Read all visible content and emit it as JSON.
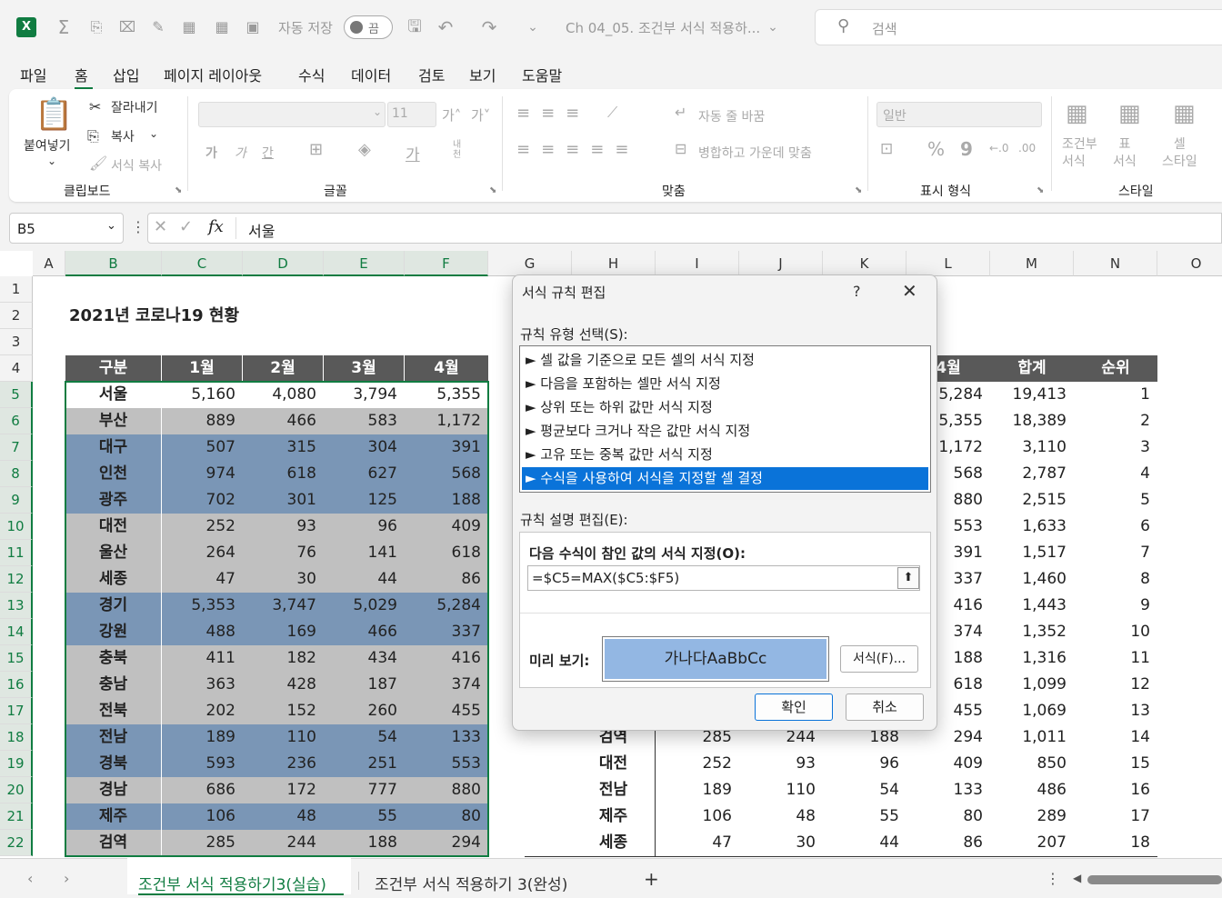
{
  "titlebar": {
    "autosave_label": "자동 저장",
    "autosave_state": "끔",
    "doc_title": "Ch 04_05. 조건부 서식 적용하...",
    "search_placeholder": "검색"
  },
  "menu_tabs": [
    "파일",
    "홈",
    "삽입",
    "페이지 레이아웃",
    "수식",
    "데이터",
    "검토",
    "보기",
    "도움말"
  ],
  "ribbon": {
    "paste": "붙여넣기",
    "cut": "잘라내기",
    "copy": "복사",
    "format_painter": "서식 복사",
    "clipboard_group": "클립보드",
    "font_size": "11",
    "font_group": "글꼴",
    "wrap_text": "자동 줄 바꿈",
    "merge_center": "병합하고 가운데 맞춤",
    "align_group": "맞춤",
    "number_format": "일반",
    "number_group": "표시 형식",
    "cond_format": "조건부\n서식",
    "format_table": "표\n서식",
    "cell_style": "셀\n스타일",
    "style_group": "스타일",
    "font_bold": "가",
    "font_italic": "가",
    "font_underline": "간",
    "font_color": "가",
    "vertical": "내천"
  },
  "formula_bar": {
    "name_box": "B5",
    "fx": "fx",
    "content": "서울"
  },
  "columns": [
    "A",
    "B",
    "C",
    "D",
    "E",
    "F",
    "G",
    "H",
    "I",
    "J",
    "K",
    "L",
    "M",
    "N",
    "O"
  ],
  "rows": [
    "1",
    "2",
    "3",
    "4",
    "5",
    "6",
    "7",
    "8",
    "9",
    "10",
    "11",
    "12",
    "13",
    "14",
    "15",
    "16",
    "17",
    "18",
    "19",
    "20",
    "21",
    "22"
  ],
  "sheet_title": "2021년 코로나19 현황",
  "left_table": {
    "headers": [
      "구분",
      "1월",
      "2월",
      "3월",
      "4월"
    ],
    "rows": [
      {
        "name": "서울",
        "v": [
          "5,160",
          "4,080",
          "3,794",
          "5,355"
        ],
        "style": "white"
      },
      {
        "name": "부산",
        "v": [
          "889",
          "466",
          "583",
          "1,172"
        ],
        "style": "gray"
      },
      {
        "name": "대구",
        "v": [
          "507",
          "315",
          "304",
          "391"
        ],
        "style": "blue"
      },
      {
        "name": "인천",
        "v": [
          "974",
          "618",
          "627",
          "568"
        ],
        "style": "blue"
      },
      {
        "name": "광주",
        "v": [
          "702",
          "301",
          "125",
          "188"
        ],
        "style": "blue"
      },
      {
        "name": "대전",
        "v": [
          "252",
          "93",
          "96",
          "409"
        ],
        "style": "gray"
      },
      {
        "name": "울산",
        "v": [
          "264",
          "76",
          "141",
          "618"
        ],
        "style": "gray"
      },
      {
        "name": "세종",
        "v": [
          "47",
          "30",
          "44",
          "86"
        ],
        "style": "gray"
      },
      {
        "name": "경기",
        "v": [
          "5,353",
          "3,747",
          "5,029",
          "5,284"
        ],
        "style": "blue"
      },
      {
        "name": "강원",
        "v": [
          "488",
          "169",
          "466",
          "337"
        ],
        "style": "blue"
      },
      {
        "name": "충북",
        "v": [
          "411",
          "182",
          "434",
          "416"
        ],
        "style": "gray"
      },
      {
        "name": "충남",
        "v": [
          "363",
          "428",
          "187",
          "374"
        ],
        "style": "gray"
      },
      {
        "name": "전북",
        "v": [
          "202",
          "152",
          "260",
          "455"
        ],
        "style": "gray"
      },
      {
        "name": "전남",
        "v": [
          "189",
          "110",
          "54",
          "133"
        ],
        "style": "blue"
      },
      {
        "name": "경북",
        "v": [
          "593",
          "236",
          "251",
          "553"
        ],
        "style": "blue"
      },
      {
        "name": "경남",
        "v": [
          "686",
          "172",
          "777",
          "880"
        ],
        "style": "gray"
      },
      {
        "name": "제주",
        "v": [
          "106",
          "48",
          "55",
          "80"
        ],
        "style": "blue"
      },
      {
        "name": "검역",
        "v": [
          "285",
          "244",
          "188",
          "294"
        ],
        "style": "gray"
      }
    ]
  },
  "right_table": {
    "headers": [
      "4월",
      "합계",
      "순위"
    ],
    "rows": [
      {
        "h": "",
        "i": "",
        "j": "",
        "k": "",
        "l": "5,284",
        "m": "19,413",
        "n": "1"
      },
      {
        "h": "",
        "i": "",
        "j": "",
        "k": "",
        "l": "5,355",
        "m": "18,389",
        "n": "2"
      },
      {
        "h": "",
        "i": "",
        "j": "",
        "k": "",
        "l": "1,172",
        "m": "3,110",
        "n": "3"
      },
      {
        "h": "",
        "i": "",
        "j": "",
        "k": "",
        "l": "568",
        "m": "2,787",
        "n": "4"
      },
      {
        "h": "",
        "i": "",
        "j": "",
        "k": "",
        "l": "880",
        "m": "2,515",
        "n": "5"
      },
      {
        "h": "",
        "i": "",
        "j": "",
        "k": "",
        "l": "553",
        "m": "1,633",
        "n": "6"
      },
      {
        "h": "",
        "i": "",
        "j": "",
        "k": "",
        "l": "391",
        "m": "1,517",
        "n": "7"
      },
      {
        "h": "",
        "i": "",
        "j": "",
        "k": "",
        "l": "337",
        "m": "1,460",
        "n": "8"
      },
      {
        "h": "",
        "i": "",
        "j": "",
        "k": "",
        "l": "416",
        "m": "1,443",
        "n": "9"
      },
      {
        "h": "",
        "i": "",
        "j": "",
        "k": "",
        "l": "374",
        "m": "1,352",
        "n": "10"
      },
      {
        "h": "",
        "i": "",
        "j": "",
        "k": "",
        "l": "188",
        "m": "1,316",
        "n": "11"
      },
      {
        "h": "",
        "i": "",
        "j": "",
        "k": "",
        "l": "618",
        "m": "1,099",
        "n": "12"
      },
      {
        "h": "",
        "i": "",
        "j": "",
        "k": "",
        "l": "455",
        "m": "1,069",
        "n": "13"
      },
      {
        "h": "검역",
        "i": "285",
        "j": "244",
        "k": "188",
        "l": "294",
        "m": "1,011",
        "n": "14"
      },
      {
        "h": "대전",
        "i": "252",
        "j": "93",
        "k": "96",
        "l": "409",
        "m": "850",
        "n": "15"
      },
      {
        "h": "전남",
        "i": "189",
        "j": "110",
        "k": "54",
        "l": "133",
        "m": "486",
        "n": "16"
      },
      {
        "h": "제주",
        "i": "106",
        "j": "48",
        "k": "55",
        "l": "80",
        "m": "289",
        "n": "17"
      },
      {
        "h": "세종",
        "i": "47",
        "j": "30",
        "k": "44",
        "l": "86",
        "m": "207",
        "n": "18"
      }
    ]
  },
  "dialog": {
    "title": "서식 규칙 편집",
    "help": "?",
    "close": "✕",
    "rule_type_label": "규칙 유형 선택(S):",
    "rule_types": [
      "► 셀 값을 기준으로 모든 셀의 서식 지정",
      "► 다음을 포함하는 셀만 서식 지정",
      "► 상위 또는 하위 값만 서식 지정",
      "► 평균보다 크거나 작은 값만 서식 지정",
      "► 고유 또는 중복 값만 서식 지정",
      "► 수식을 사용하여 서식을 지정할 셀 결정"
    ],
    "rule_desc_label": "규칙 설명 편집(E):",
    "formula_label": "다음 수식이 참인 값의 서식 지정(O):",
    "formula_value": "=$C5=MAX($C5:$F5)",
    "preview_label": "미리 보기:",
    "preview_text": "가나다AaBbCc",
    "format_button": "서식(F)...",
    "ok": "확인",
    "cancel": "취소"
  },
  "sheet_tabs": [
    "조건부 서식 적용하기3(실습)",
    "조건부 서식 적용하기 3(완성)"
  ],
  "add_sheet": "+",
  "colors": {
    "header_bg": "#595959",
    "highlight_blue": "#7a96b6",
    "gray_fill": "#c0c0c0",
    "excel_green": "#107c41",
    "selection_blue": "#0a73d9"
  }
}
